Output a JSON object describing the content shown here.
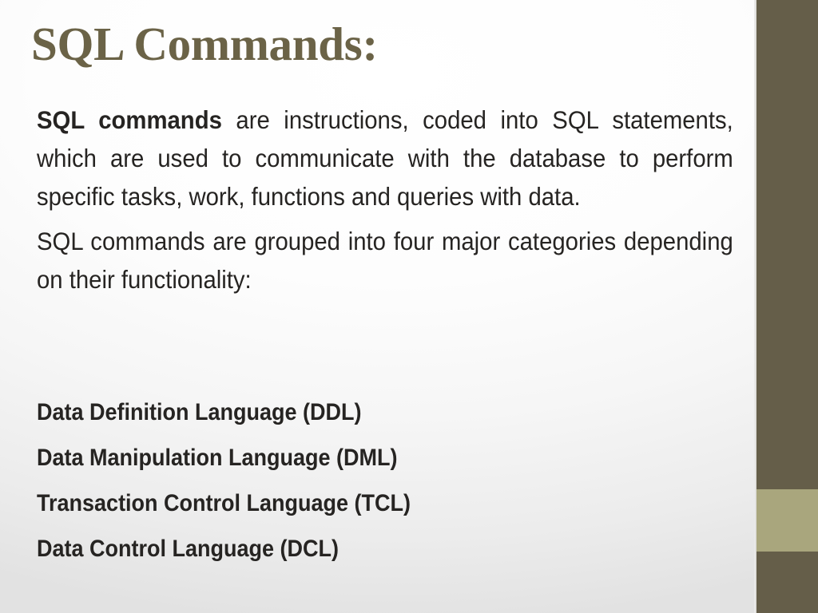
{
  "slide": {
    "title": "SQL Commands:",
    "paragraphs": [
      {
        "lead": "SQL commands",
        "rest": " are instructions, coded into SQL statements, which are used to communicate with the database to perform specific tasks, work, functions and queries with data."
      },
      {
        "lead": "",
        "rest": "SQL commands are grouped into four major categories depending on their functionality:"
      }
    ],
    "list": [
      "Data Definition Language (DDL)",
      "Data Manipulation Language (DML)",
      "Transaction Control Language (TCL)",
      "Data Control Language (DCL)"
    ]
  },
  "theme": {
    "title_color": "#6B6347",
    "body_color": "#262422",
    "sidebar_color": "#655E49",
    "sidebar_band_color": "#A9A67D",
    "background_color": "#FFFFFF"
  }
}
